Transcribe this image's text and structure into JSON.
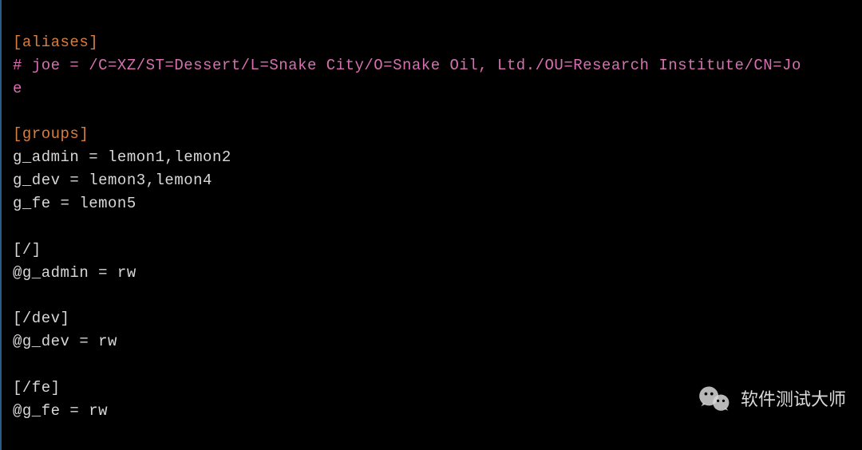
{
  "lines": {
    "l1": "[aliases]",
    "l2_hash": "# ",
    "l2_rest": "joe = /C=XZ/ST=Dessert/L=Snake City/O=Snake Oil, Ltd./OU=Research Institute/CN=Jo",
    "l3": "e",
    "l4": "",
    "l5": "[groups]",
    "l6": "g_admin = lemon1,lemon2",
    "l7": "g_dev = lemon3,lemon4",
    "l8": "g_fe = lemon5",
    "l9": "",
    "l10": "[/]",
    "l11": "@g_admin = rw",
    "l12": "",
    "l13": "[/dev]",
    "l14": "@g_dev = rw",
    "l15": "",
    "l16": "[/fe]",
    "l17": "@g_fe = rw"
  },
  "watermark": {
    "label": "软件测试大师"
  }
}
